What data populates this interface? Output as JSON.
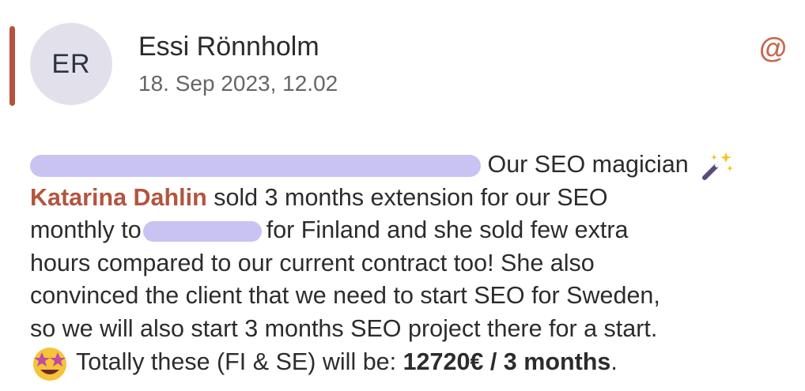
{
  "message": {
    "avatar_initials": "ER",
    "sender_name": "Essi Rönnholm",
    "timestamp": "18. Sep 2023, 12.02",
    "mention_icon": "@",
    "accent_color": "#b5523f",
    "body": {
      "line1_text": "Our SEO magician",
      "mentioned_person": "Katarina Dahlin",
      "line2_rest": " sold 3 months extension for our SEO",
      "line3_prefix": "monthly to",
      "line3_suffix": "for Finland and she sold few extra",
      "line4": "hours compared to our current contract too! She also",
      "line5": "convinced the client that we need to start SEO for Sweden,",
      "line6": "so we will also start 3 months SEO project there for a start.",
      "line7_prefix": "Totally these (FI & SE) will be: ",
      "line7_total": "12720€ / 3 months",
      "line7_end": "."
    },
    "icons": [
      "magic-wand-emoji",
      "star-struck-emoji"
    ]
  }
}
